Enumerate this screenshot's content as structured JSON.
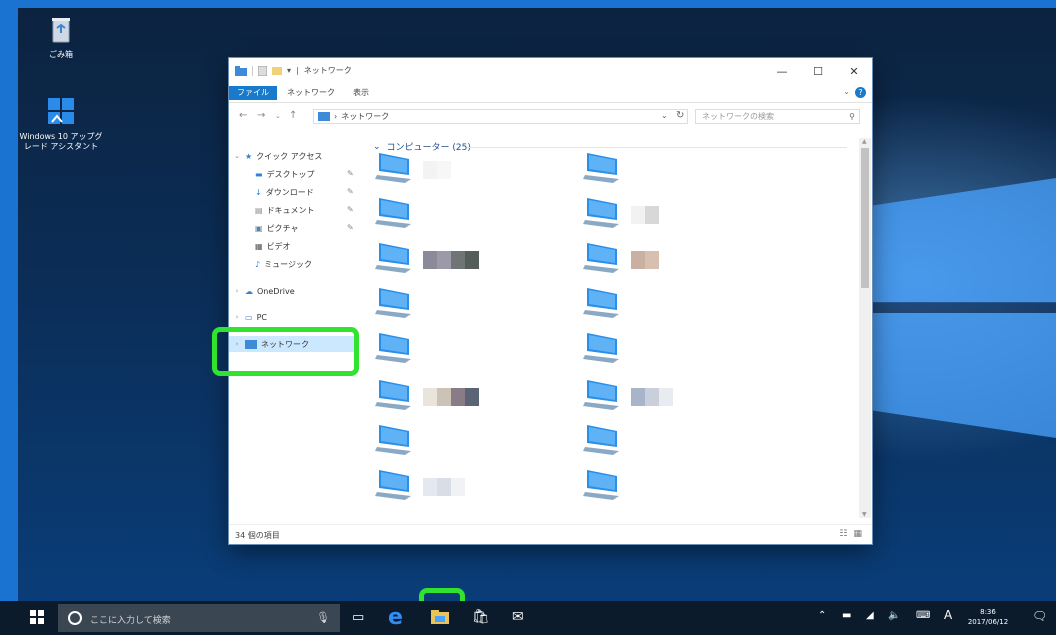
{
  "desktop": {
    "icons": [
      {
        "label": "ごみ箱"
      },
      {
        "label_line1": "Windows 10 アップグ",
        "label_line2": "レード アシスタント"
      }
    ]
  },
  "explorer": {
    "title": "ネットワーク",
    "ribbon_tabs": {
      "file": "ファイル",
      "network": "ネットワーク",
      "view": "表示"
    },
    "help": "?",
    "address": {
      "path": "ネットワーク",
      "search_placeholder": "ネットワークの検索"
    },
    "nav": {
      "quick_access": "クイック アクセス",
      "desktop": "デスクトップ",
      "downloads": "ダウンロード",
      "documents": "ドキュメント",
      "pictures": "ピクチャ",
      "videos": "ビデオ",
      "music": "ミュージック",
      "onedrive": "OneDrive",
      "pc": "PC",
      "network": "ネットワーク"
    },
    "group_header": "コンピューター (25)",
    "status": "34 個の項目"
  },
  "computers": {
    "left": [
      {
        "colors": [
          "#f3f3f3",
          "#f7f7f7"
        ]
      },
      {
        "colors": []
      },
      {
        "colors": [
          "#8a8a9a",
          "#9c9aa8",
          "#6f7475",
          "#555d5a"
        ]
      },
      {
        "colors": []
      },
      {
        "colors": []
      },
      {
        "colors": [
          "#e9e5dc",
          "#cbc3b5",
          "#8a7c86",
          "#5b6474"
        ]
      },
      {
        "colors": []
      },
      {
        "colors": [
          "#e4e8f0",
          "#d9dde8",
          "#f0f2f6"
        ]
      }
    ],
    "right": [
      {
        "colors": []
      },
      {
        "colors": [
          "#f2f2f2",
          "#d8d8d8"
        ]
      },
      {
        "colors": [
          "#c9b0a3",
          "#d8c0b0"
        ]
      },
      {
        "colors": []
      },
      {
        "colors": []
      },
      {
        "colors": [
          "#a8b4c8",
          "#c9d0dc",
          "#e8ebf0"
        ]
      },
      {
        "colors": []
      },
      {
        "colors": []
      }
    ]
  },
  "taskbar": {
    "search_placeholder": "ここに入力して検索",
    "time": "8:36",
    "date": "2017/06/12",
    "ime": "A"
  }
}
